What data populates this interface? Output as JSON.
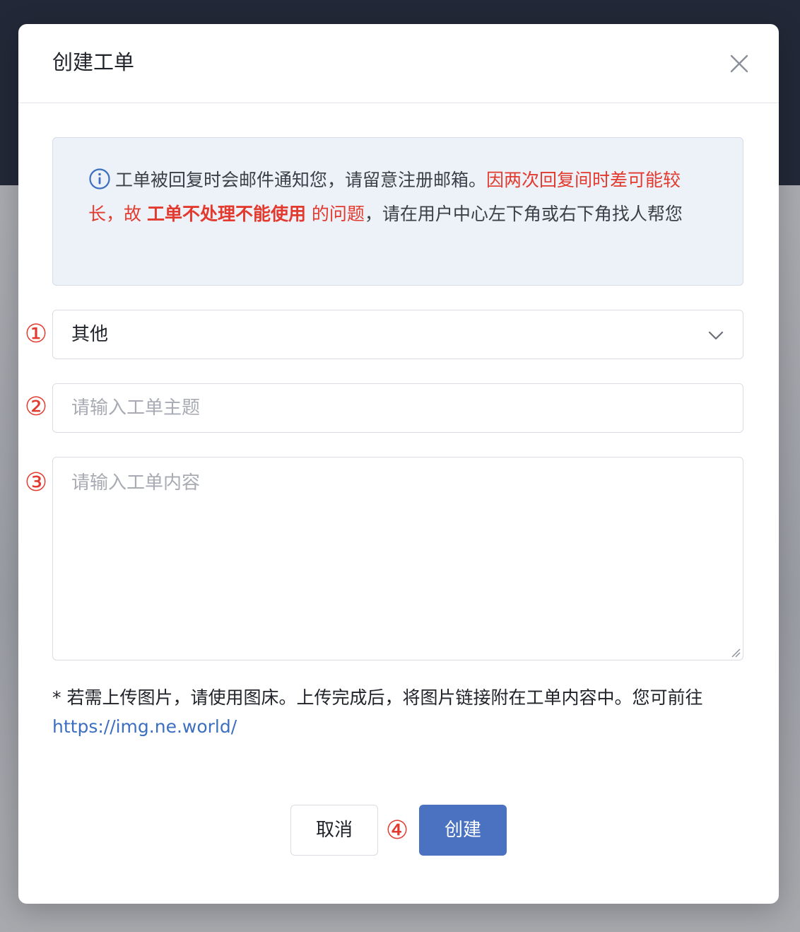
{
  "dialog": {
    "title": "创建工单",
    "close_icon": "close-icon"
  },
  "notice": {
    "icon": "info-icon",
    "text_normal_1": "工单被回复时会邮件通知您，请留意注册邮箱。",
    "text_red_1": "因两次回复间时差可能较长，故 ",
    "text_red_bold": "工单不处理不能使用",
    "text_red_2": " 的问题",
    "text_normal_2": "，请在用户中心左下角或右下角找人帮您",
    "accent_color": "#e23a2e"
  },
  "markers": {
    "one": "①",
    "two": "②",
    "three": "③",
    "four": "④"
  },
  "form": {
    "category": {
      "selected": "其他",
      "icon": "chevron-down-icon"
    },
    "subject": {
      "placeholder": "请输入工单主题",
      "value": ""
    },
    "content": {
      "placeholder": "请输入工单内容",
      "value": ""
    }
  },
  "hint": {
    "text": "* 若需上传图片，请使用图床。上传完成后，将图片链接附在工单内容中。您可前往 ",
    "link": "https://img.ne.world/"
  },
  "buttons": {
    "cancel": "取消",
    "create": "创建",
    "primary_color": "#4a72c0"
  }
}
